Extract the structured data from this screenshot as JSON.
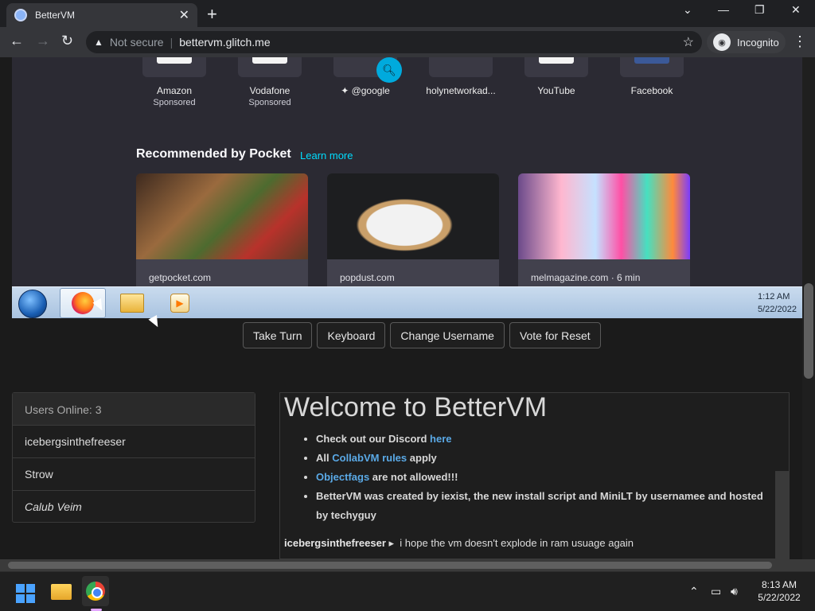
{
  "browser": {
    "tab_title": "BetterVM",
    "new_tab": "+",
    "tab_close": "✕",
    "not_secure": "Not secure",
    "url": "bettervm.glitch.me",
    "incognito_label": "Incognito",
    "window_controls": [
      "⌄",
      "—",
      "❐",
      "✕"
    ]
  },
  "vm": {
    "top_sites": [
      {
        "label": "Amazon",
        "sub": "Sponsored"
      },
      {
        "label": "Vodafone",
        "sub": "Sponsored"
      },
      {
        "label": "@google",
        "sub": ""
      },
      {
        "label": "holynetworkad...",
        "sub": ""
      },
      {
        "label": "YouTube",
        "sub": ""
      },
      {
        "label": "Facebook",
        "sub": ""
      }
    ],
    "pocket_heading": "Recommended by Pocket",
    "learn_more": "Learn more",
    "cards": [
      {
        "source": "getpocket.com"
      },
      {
        "source": "popdust.com"
      },
      {
        "source": "melmagazine.com · 6 min"
      }
    ],
    "taskbar_time": "1:12 AM",
    "taskbar_date": "5/22/2022"
  },
  "controls": {
    "take_turn": "Take Turn",
    "keyboard": "Keyboard",
    "change_username": "Change Username",
    "vote_for_reset": "Vote for Reset"
  },
  "users": {
    "header": "Users Online: 3",
    "list": [
      "icebergsinthefreeser",
      "Strow",
      "Calub Veim"
    ]
  },
  "chat": {
    "title": "Welcome to BetterVM",
    "bullets": {
      "b1_text": "Check out our Discord ",
      "b1_link": "here",
      "b2_pre": "All ",
      "b2_link": "CollabVM rules",
      "b2_post": " apply",
      "b3_link": "Objectfags",
      "b3_post": " are not allowed!!!",
      "b4_text": "BetterVM was created by iexist, the new install script and MiniLT by usernamee and hosted by techyguy"
    },
    "message_user": "icebergsinthefreeser",
    "message_arrow": "▸",
    "message_text": "i hope the vm doesn't explode in ram usuage again"
  },
  "host_taskbar": {
    "time": "8:13 AM",
    "date": "5/22/2022"
  },
  "colors": {
    "link": "#5aa9e6",
    "pocket_link": "#00ddff",
    "accent_search": "#00aadd"
  }
}
